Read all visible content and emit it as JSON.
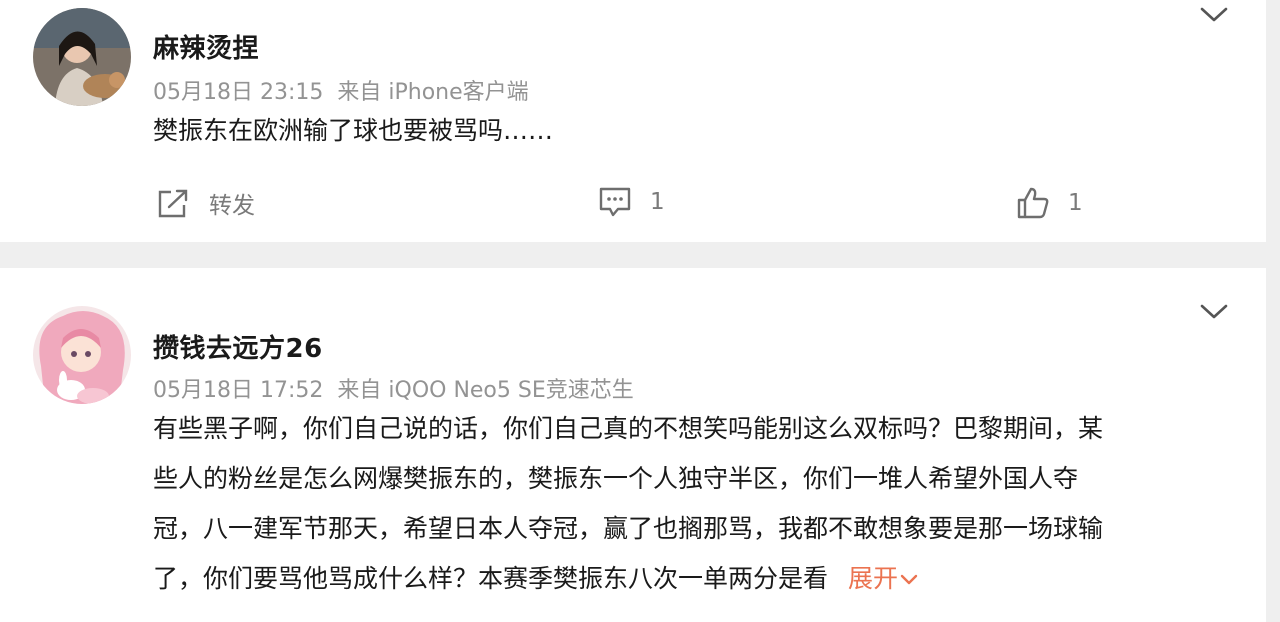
{
  "comments": [
    {
      "username": "麻辣烫捏",
      "date": "05月18日 23:15",
      "source": "来自 iPhone客户端",
      "content_lines": [
        "樊振东在欧洲输了球也要被骂吗……"
      ],
      "actions": {
        "repost_label": "转发",
        "comment_count": "1",
        "like_count": "1"
      }
    },
    {
      "username": "攒钱去远方26",
      "date": "05月18日 17:52",
      "source": "来自 iQOO Neo5 SE竞速芯生",
      "content_lines": [
        "有些黑子啊，你们自己说的话，你们自己真的不想笑吗能别这么双标吗？巴黎期间，某",
        "些人的粉丝是怎么网爆樊振东的，樊振东一个人独守半区，你们一堆人希望外国人夺",
        "冠，八一建军节那天，希望日本人夺冠，赢了也搁那骂，我都不敢想象要是那一场球输",
        "了，你们要骂他骂成什么样？本赛季樊振东八次一单两分是看"
      ],
      "expand_label": "展开"
    }
  ],
  "colors": {
    "text_primary": "#1a1a1a",
    "text_meta": "#939393",
    "expand_accent": "#eb7350",
    "page_background": "#efefef",
    "card_background": "#ffffff"
  },
  "icons": [
    "chevron-down-icon",
    "repost-icon",
    "comment-icon",
    "like-icon"
  ]
}
